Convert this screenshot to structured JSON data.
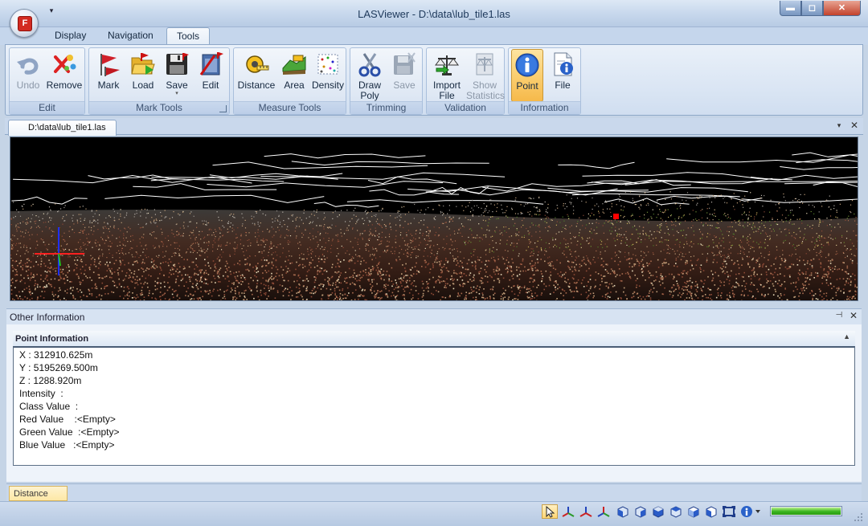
{
  "window": {
    "title": "LASViewer - D:\\data\\lub_tile1.las",
    "orb_letter": "F",
    "qat_arrow": "▾",
    "min": "▬",
    "max": "◻",
    "close": "✕"
  },
  "ribbon": {
    "tabs": [
      "Display",
      "Navigation",
      "Tools"
    ],
    "active_tab": "Tools",
    "groups": {
      "edit": {
        "label": "Edit",
        "undo": "Undo",
        "remove": "Remove"
      },
      "mark_tools": {
        "label": "Mark Tools",
        "mark": "Mark",
        "load": "Load",
        "save": "Save",
        "save_arrow": "▾",
        "edit": "Edit"
      },
      "measure_tools": {
        "label": "Measure Tools",
        "distance": "Distance",
        "area": "Area",
        "density": "Density"
      },
      "trimming": {
        "label": "Trimming",
        "draw_poly": "Draw\nPoly",
        "save": "Save"
      },
      "validation": {
        "label": "Validation",
        "import_file": "Import\nFile",
        "show_statistics": "Show\nStatistics"
      },
      "information": {
        "label": "Information",
        "point": "Point",
        "file": "File"
      }
    },
    "colors": {
      "active_button": "#f6b94a"
    }
  },
  "document": {
    "tab_label": "D:\\data\\lub_tile1.las",
    "menu_glyph": "▾",
    "close_glyph": "✕"
  },
  "viewport": {
    "background": "#000000",
    "marker_color": "#ff0000"
  },
  "info_panel": {
    "title": "Other Information",
    "pin_glyph": "⊣",
    "close_glyph": "✕",
    "section_title": "Point Information",
    "collapse_glyph": "▲",
    "rows": [
      "X : 312910.625m",
      "Y : 5195269.500m",
      "Z : 1288.920m",
      "Intensity  :",
      "Class Value  :",
      "Red Value    :<Empty>",
      "Green Value  :<Empty>",
      "Blue Value   :<Empty>"
    ]
  },
  "bottom_tab": {
    "label": "Distance"
  },
  "statusbar": {
    "icons": [
      "select-arrow-icon",
      "axis-x-icon",
      "axis-y-icon",
      "axis-z-icon",
      "view-front-icon",
      "view-back-icon",
      "view-left-icon",
      "view-right-icon",
      "view-top-icon",
      "view-bottom-icon",
      "fit-extent-icon",
      "info-icon"
    ],
    "progress": 1.0,
    "progress_color": "#39b51f"
  }
}
